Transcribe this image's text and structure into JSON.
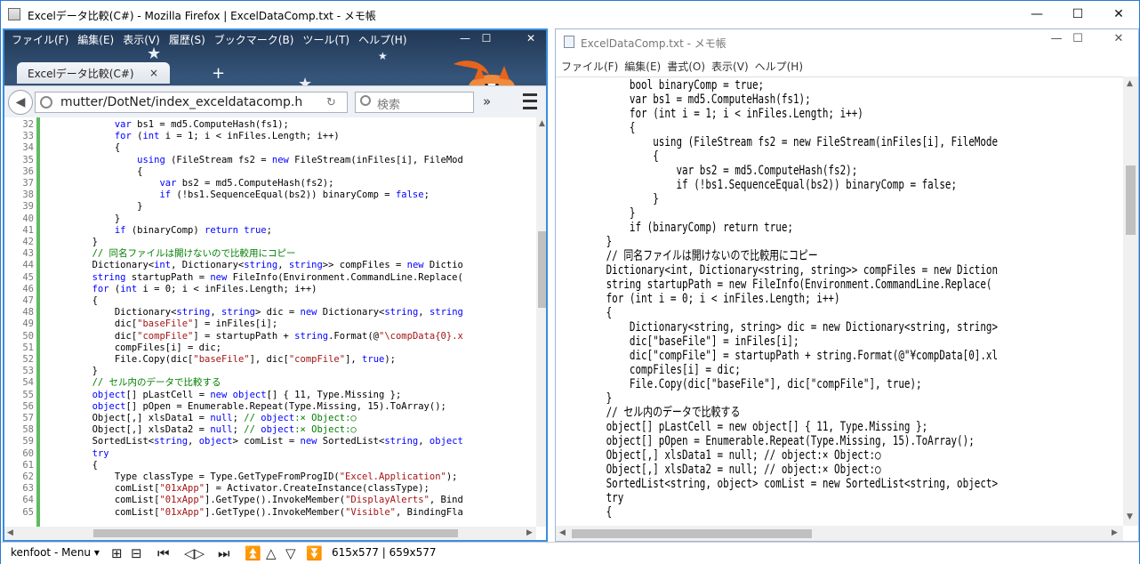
{
  "window": {
    "title": "Excelデータ比較(C#) - Mozilla Firefox | ExcelDataComp.txt - メモ帳",
    "minimize": "—",
    "maximize": "☐",
    "close": "✕"
  },
  "firefox": {
    "menu": [
      "ファイル(F)",
      "編集(E)",
      "表示(V)",
      "履歴(S)",
      "ブックマーク(B)",
      "ツール(T)",
      "ヘルプ(H)"
    ],
    "tab_title": "Excelデータ比較(C#)",
    "tab_close": "×",
    "new_tab": "+",
    "url": "mutter/DotNet/index_exceldatacomp.h",
    "search_placeholder": "検索",
    "overflow": "»",
    "code_lines": [
      {
        "n": "32",
        "t": "            var bs1 = md5.ComputeHash(fs1);"
      },
      {
        "n": "33",
        "t": "            for (int i = 1; i < inFiles.Length; i++)"
      },
      {
        "n": "34",
        "t": "            {"
      },
      {
        "n": "35",
        "t": "                using (FileStream fs2 = new FileStream(inFiles[i], FileMod"
      },
      {
        "n": "36",
        "t": "                {"
      },
      {
        "n": "37",
        "t": "                    var bs2 = md5.ComputeHash(fs2);"
      },
      {
        "n": "38",
        "t": "                    if (!bs1.SequenceEqual(bs2)) binaryComp = false;"
      },
      {
        "n": "39",
        "t": "                }"
      },
      {
        "n": "40",
        "t": "            }"
      },
      {
        "n": "41",
        "t": "            if (binaryComp) return true;"
      },
      {
        "n": "42",
        "t": "        }"
      },
      {
        "n": "43",
        "t": "        // 同名ファイルは開けないので比較用にコピー"
      },
      {
        "n": "44",
        "t": "        Dictionary<int, Dictionary<string, string>> compFiles = new Dictio"
      },
      {
        "n": "45",
        "t": "        string startupPath = new FileInfo(Environment.CommandLine.Replace("
      },
      {
        "n": "46",
        "t": "        for (int i = 0; i < inFiles.Length; i++)"
      },
      {
        "n": "47",
        "t": "        {"
      },
      {
        "n": "48",
        "t": "            Dictionary<string, string> dic = new Dictionary<string, string"
      },
      {
        "n": "49",
        "t": "            dic[\"baseFile\"] = inFiles[i];"
      },
      {
        "n": "50",
        "t": "            dic[\"compFile\"] = startupPath + string.Format(@\"\\compData{0}.x"
      },
      {
        "n": "51",
        "t": "            compFiles[i] = dic;"
      },
      {
        "n": "52",
        "t": "            File.Copy(dic[\"baseFile\"], dic[\"compFile\"], true);"
      },
      {
        "n": "53",
        "t": "        }"
      },
      {
        "n": "54",
        "t": "        // セル内のデータで比較する"
      },
      {
        "n": "55",
        "t": "        object[] pLastCell = new object[] { 11, Type.Missing };"
      },
      {
        "n": "56",
        "t": "        object[] pOpen = Enumerable.Repeat(Type.Missing, 15).ToArray();"
      },
      {
        "n": "57",
        "t": "        Object[,] xlsData1 = null; // object:× Object:○"
      },
      {
        "n": "58",
        "t": "        Object[,] xlsData2 = null; // object:× Object:○"
      },
      {
        "n": "59",
        "t": "        SortedList<string, object> comList = new SortedList<string, object"
      },
      {
        "n": "60",
        "t": "        try"
      },
      {
        "n": "61",
        "t": "        {"
      },
      {
        "n": "62",
        "t": "            Type classType = Type.GetTypeFromProgID(\"Excel.Application\");"
      },
      {
        "n": "63",
        "t": "            comList[\"01xApp\"] = Activator.CreateInstance(classType);"
      },
      {
        "n": "64",
        "t": "            comList[\"01xApp\"].GetType().InvokeMember(\"DisplayAlerts\", Bind"
      },
      {
        "n": "65",
        "t": "            comList[\"01xApp\"].GetType().InvokeMember(\"Visible\", BindingFla"
      }
    ]
  },
  "notepad": {
    "title": "ExcelDataComp.txt - メモ帳",
    "menu": [
      "ファイル(F)",
      "編集(E)",
      "書式(O)",
      "表示(V)",
      "ヘルプ(H)"
    ],
    "lines": [
      "            bool binaryComp = true;",
      "            var bs1 = md5.ComputeHash(fs1);",
      "            for (int i = 1; i < inFiles.Length; i++)",
      "            {",
      "                using (FileStream fs2 = new FileStream(inFiles[i], FileMode",
      "                {",
      "                    var bs2 = md5.ComputeHash(fs2);",
      "                    if (!bs1.SequenceEqual(bs2)) binaryComp = false;",
      "                }",
      "            }",
      "            if (binaryComp) return true;",
      "        }",
      "        // 同名ファイルは開けないので比較用にコピー",
      "        Dictionary<int, Dictionary<string, string>> compFiles = new Diction",
      "        string startupPath = new FileInfo(Environment.CommandLine.Replace(",
      "        for (int i = 0; i < inFiles.Length; i++)",
      "        {",
      "            Dictionary<string, string> dic = new Dictionary<string, string>",
      "            dic[\"baseFile\"] = inFiles[i];",
      "            dic[\"compFile\"] = startupPath + string.Format(@\"¥compData[0].xl",
      "            compFiles[i] = dic;",
      "            File.Copy(dic[\"baseFile\"], dic[\"compFile\"], true);",
      "        }",
      "        // セル内のデータで比較する",
      "        object[] pLastCell = new object[] { 11, Type.Missing };",
      "        object[] pOpen = Enumerable.Repeat(Type.Missing, 15).ToArray();",
      "        Object[,] xlsData1 = null; // object:× Object:○",
      "        Object[,] xlsData2 = null; // object:× Object:○",
      "        SortedList<string, object> comList = new SortedList<string, object>",
      "        try",
      "        {"
    ]
  },
  "status": {
    "menu": "kenfoot - Menu ▾",
    "dims": "615x577 | 659x577"
  }
}
